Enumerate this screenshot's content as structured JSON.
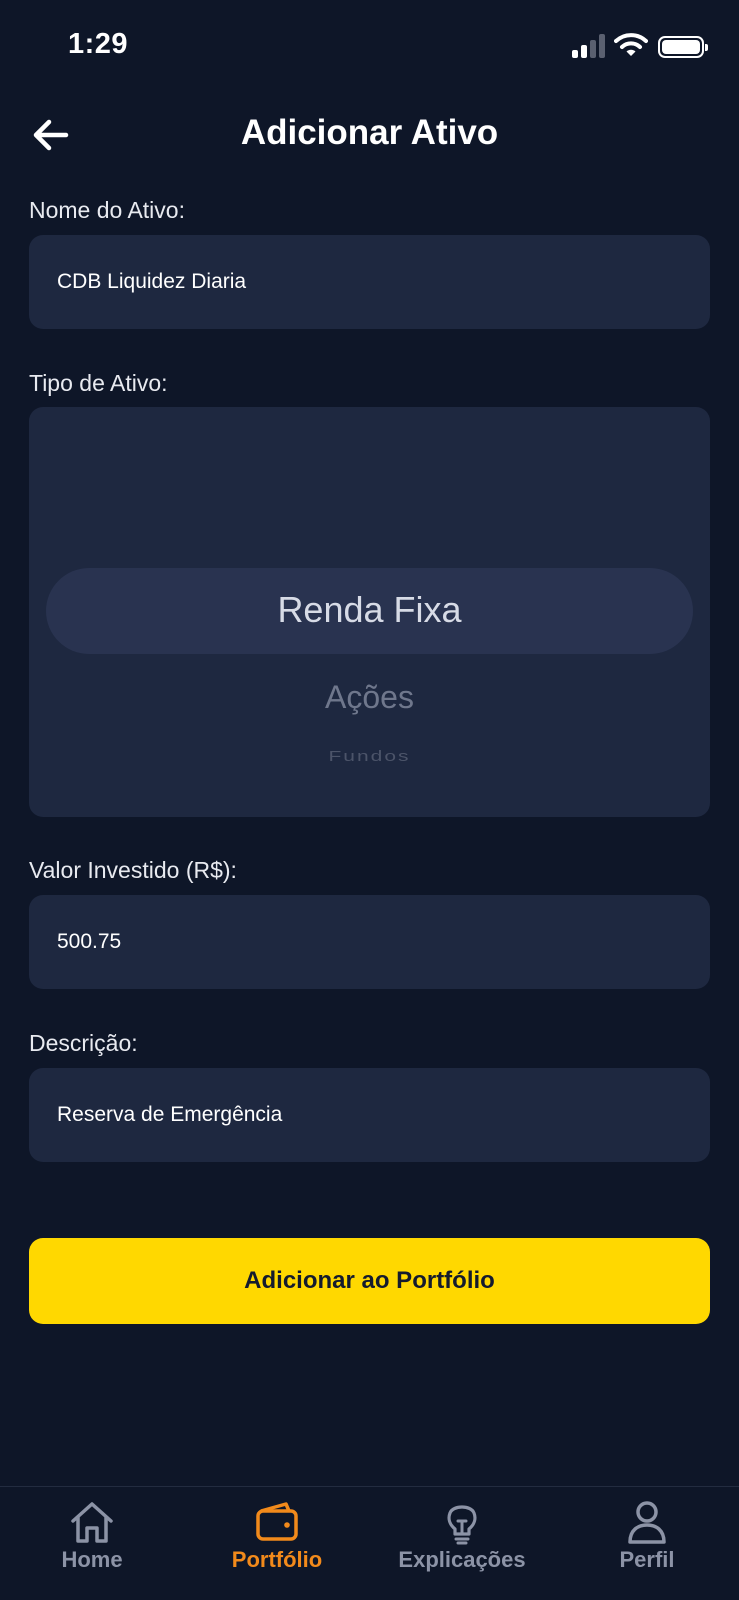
{
  "status_bar": {
    "time": "1:29"
  },
  "header": {
    "title": "Adicionar Ativo"
  },
  "form": {
    "name_label": "Nome do Ativo:",
    "name_value": "CDB Liquidez Diaria",
    "type_label": "Tipo de Ativo:",
    "type_options": [
      "Renda Fixa",
      "Ações",
      "Fundos"
    ],
    "type_selected": "Renda Fixa",
    "value_label": "Valor Investido (R$):",
    "value_value": "500.75",
    "description_label": "Descrição:",
    "description_value": "Reserva de Emergência",
    "submit_label": "Adicionar ao Portfólio"
  },
  "tab_bar": {
    "items": [
      {
        "label": "Home",
        "icon": "home-icon",
        "active": false
      },
      {
        "label": "Portfólio",
        "icon": "wallet-icon",
        "active": true
      },
      {
        "label": "Explicações",
        "icon": "lightbulb-icon",
        "active": false
      },
      {
        "label": "Perfil",
        "icon": "person-icon",
        "active": false
      }
    ]
  },
  "colors": {
    "background": "#0e1628",
    "field_background": "#1e2840",
    "accent_button": "#ffd800",
    "active_tab": "#f28a1b",
    "inactive_tab": "#8c93a6"
  }
}
